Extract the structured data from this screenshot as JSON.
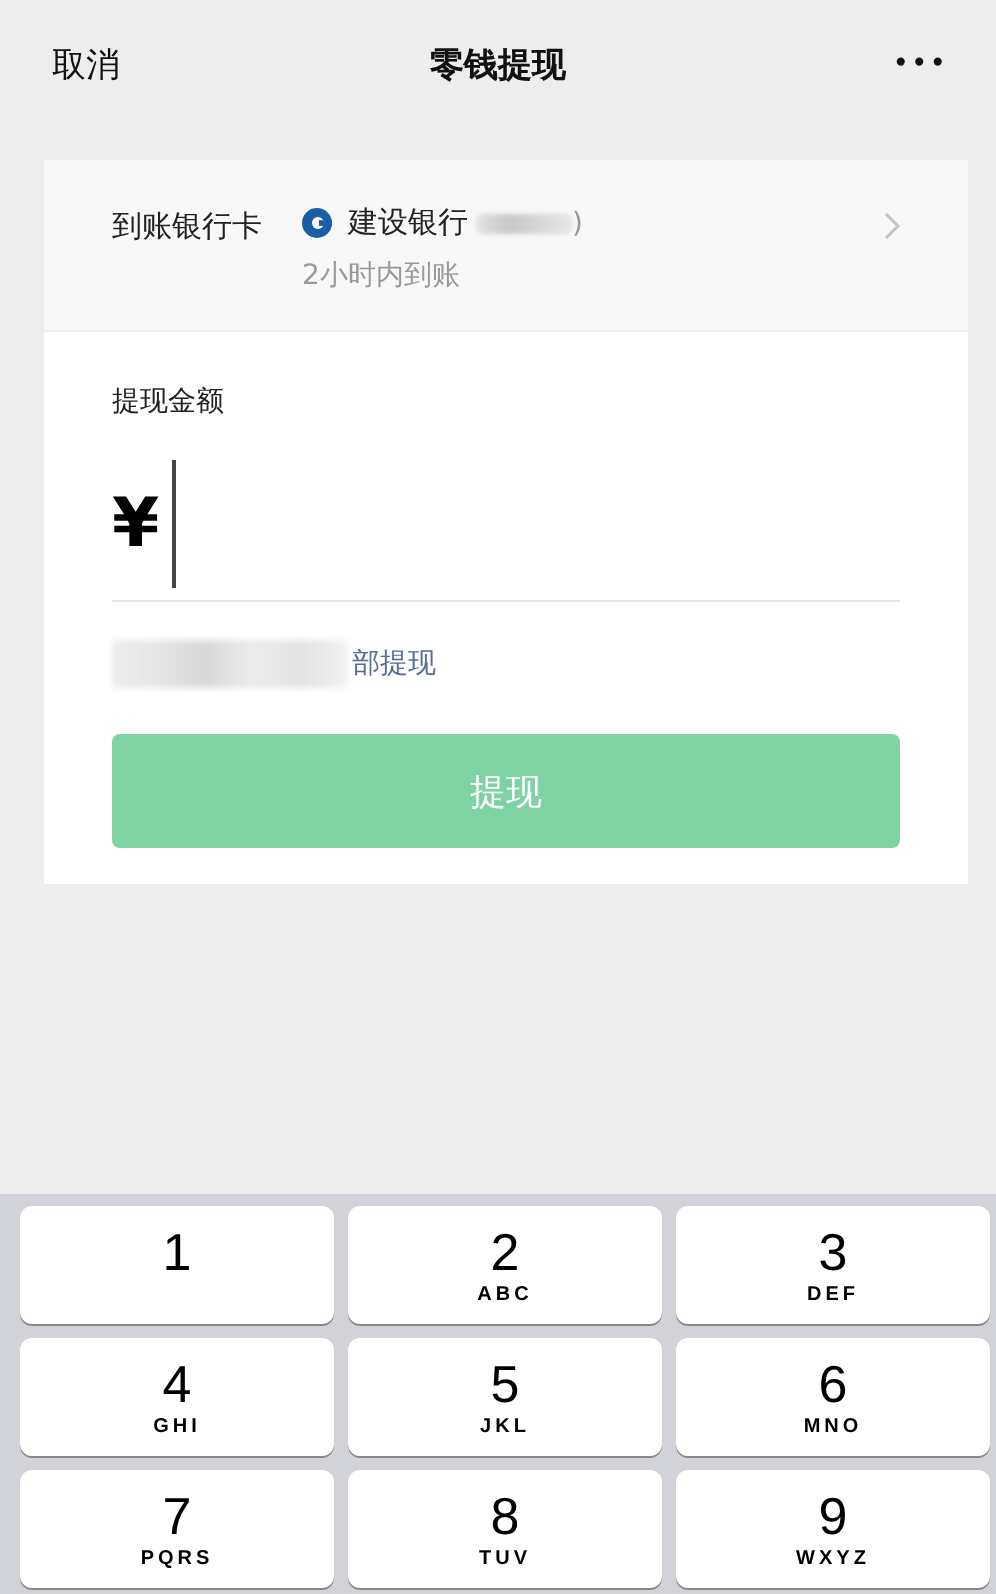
{
  "nav_bar": {
    "cancel": "取消",
    "title": "零钱提现",
    "more": "•••"
  },
  "bank_card": {
    "label": "到账银行卡",
    "bank": "建设银行",
    "suffix": ")",
    "arrival": "2小时内到账"
  },
  "amount": {
    "label": "提现金额",
    "currency": "¥",
    "focused": true,
    "withdraw_all": "部提现"
  },
  "submit": {
    "label": "提现",
    "disabled": true
  },
  "keypad": [
    {
      "digit": "1"
    },
    {
      "digit": "2",
      "letters": "ABC"
    },
    {
      "digit": "3",
      "letters": "DEF"
    },
    {
      "digit": "4",
      "letters": "GHI"
    },
    {
      "digit": "5",
      "letters": "JKL"
    },
    {
      "digit": "6",
      "letters": "MNO"
    },
    {
      "digit": "7",
      "letters": "PQRS"
    },
    {
      "digit": "8",
      "letters": "TUV"
    },
    {
      "digit": "9",
      "letters": "WXYZ"
    }
  ]
}
